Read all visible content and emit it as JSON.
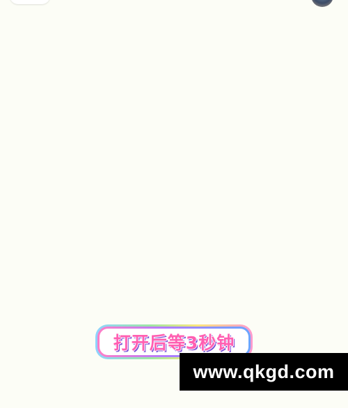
{
  "caption": {
    "text": "打开后等3秒钟"
  },
  "watermark": {
    "text": "www.qkgd.com"
  },
  "colors": {
    "background": "#fcfdf6",
    "caption_pink": "#ff5fb2",
    "watermark_bg": "#000000"
  }
}
